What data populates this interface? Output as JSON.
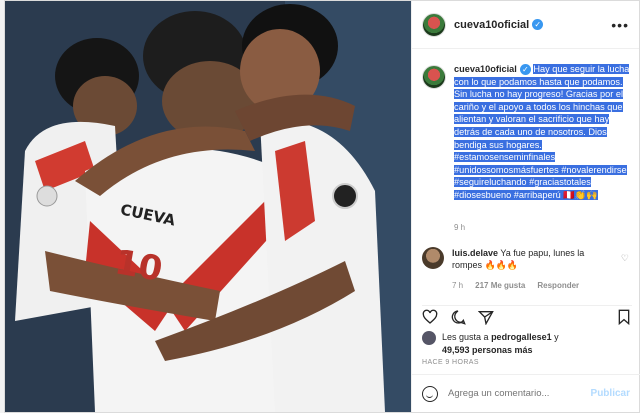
{
  "header": {
    "username": "cueva10oficial",
    "more_icon": "•••"
  },
  "caption": {
    "username": "cueva10oficial",
    "text": "Hay que seguir la lucha con lo que podamos hasta que podamos. Sin lucha no hay progreso! Gracias por el cariño y el apoyo a todos los hinchas que alientan y valoran el sacrificio que hay detrás de cada uno de nosotros. Dios bendiga sus hogares. #estamosenseminfinales #unidossomosmásfuertes #novalerendirse #seguireluchando #graciastotales #diosesbueno #arribaperú 🇵🇪👏🙌",
    "time": "9 h"
  },
  "comment": {
    "username": "luis.delave",
    "text": "Ya fue papu, lunes la rompes 🔥🔥🔥",
    "time": "7 h",
    "likes": "217 Me gusta",
    "reply": "Responder"
  },
  "likes": {
    "prefix": "Les gusta a",
    "user": "pedrogallese1",
    "suffix": "y",
    "count_text": "49,593 personas más"
  },
  "timestamp": "HACE 9 HORAS",
  "add_comment": {
    "placeholder": "Agrega un comentario...",
    "publish": "Publicar"
  },
  "photo": {
    "jersey_name": "CUEVA",
    "jersey_number": "10"
  }
}
